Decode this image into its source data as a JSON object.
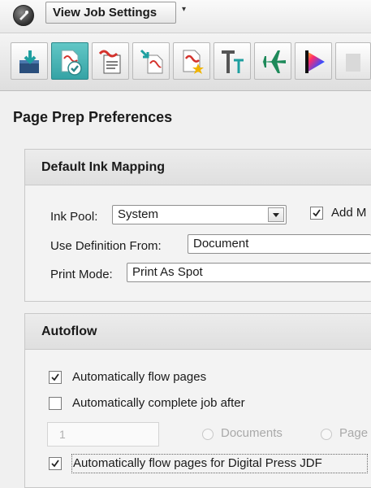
{
  "topbar": {
    "job_settings_label": "View Job Settings",
    "dropdown_caret": "▾"
  },
  "page": {
    "title": "Page Prep Preferences"
  },
  "ink_mapping": {
    "header": "Default Ink Mapping",
    "ink_pool_label": "Ink Pool:",
    "ink_pool_value": "System",
    "add_label": "Add M",
    "add_checked": true,
    "use_definition_label": "Use Definition From:",
    "use_definition_value": "Document",
    "print_mode_label": "Print Mode:",
    "print_mode_value": "Print As Spot"
  },
  "autoflow": {
    "header": "Autoflow",
    "auto_flow_label": "Automatically flow pages",
    "auto_flow_checked": true,
    "auto_complete_label": "Automatically complete job after",
    "auto_complete_checked": false,
    "count_value": "1",
    "documents_label": "Documents",
    "pages_label": "Page",
    "digital_press_label": "Automatically flow pages for Digital Press JDF",
    "digital_press_checked": true
  },
  "colors": {
    "accent_active_tool": "#46b4b5",
    "pdf_red": "#d4322c",
    "arrow_teal": "#1e9fa0"
  },
  "toolbar_icons": [
    "import-icon",
    "preflight-check-icon",
    "print-log-icon",
    "pdf-import-icon",
    "pdf-favorite-icon",
    "text-icon",
    "airplane-icon",
    "color-spectrum-icon"
  ]
}
